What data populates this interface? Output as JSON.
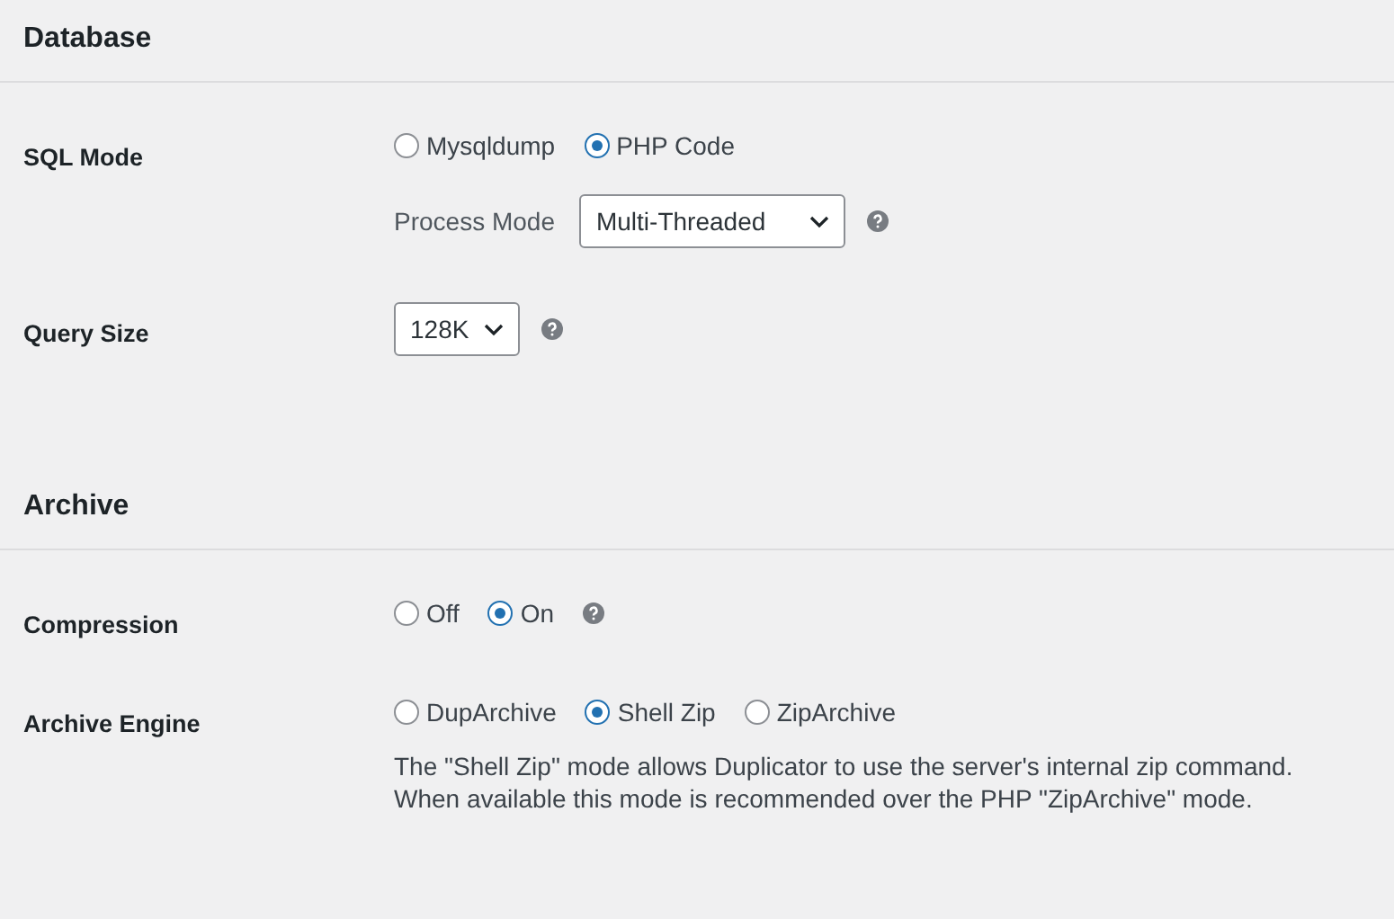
{
  "sections": [
    {
      "title": "Database",
      "rows": [
        {
          "label": "SQL Mode",
          "radios": [
            {
              "label": "Mysqldump",
              "selected": false
            },
            {
              "label": "PHP Code",
              "selected": true
            }
          ],
          "sub": {
            "label": "Process Mode",
            "select": "Multi-Threaded",
            "help": true
          }
        },
        {
          "label": "Query Size",
          "select": "128K",
          "help": true
        }
      ]
    },
    {
      "title": "Archive",
      "rows": [
        {
          "label": "Compression",
          "radios": [
            {
              "label": "Off",
              "selected": false
            },
            {
              "label": "On",
              "selected": true
            }
          ],
          "help": true
        },
        {
          "label": "Archive Engine",
          "radios": [
            {
              "label": "DupArchive",
              "selected": false
            },
            {
              "label": "Shell Zip",
              "selected": true
            },
            {
              "label": "ZipArchive",
              "selected": false
            }
          ],
          "note": "The \"Shell Zip\" mode allows Duplicator to use the server's internal zip command. When available this mode is recommended over the PHP \"ZipArchive\" mode."
        }
      ]
    }
  ]
}
